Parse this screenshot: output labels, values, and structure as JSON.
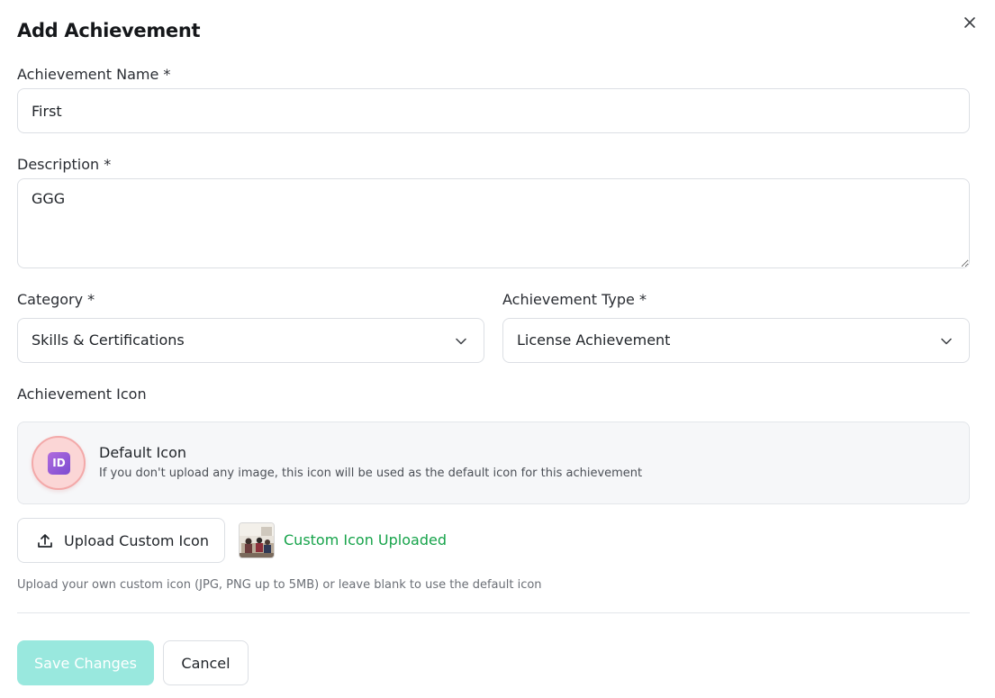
{
  "modal": {
    "title": "Add Achievement",
    "close_icon": "close-icon"
  },
  "form": {
    "name_label": "Achievement Name *",
    "name_value": "First",
    "description_label": "Description *",
    "description_value": "GGG",
    "category_label": "Category *",
    "category_value": "Skills & Certifications",
    "type_label": "Achievement Type *",
    "type_value": "License Achievement",
    "icon_label": "Achievement Icon"
  },
  "default_icon": {
    "badge_text": "ID",
    "title": "Default Icon",
    "description": "If you don't upload any image, this icon will be used as the default icon for this achievement"
  },
  "upload": {
    "button_label": "Upload Custom Icon",
    "status_text": "Custom Icon Uploaded",
    "help_text": "Upload your own custom icon (JPG, PNG up to 5MB) or leave blank to use the default icon"
  },
  "actions": {
    "save_label": "Save Changes",
    "cancel_label": "Cancel"
  },
  "colors": {
    "accent_disabled": "#99e8de",
    "success_text": "#16a34a",
    "default_icon_bg": "#fbd6d6"
  }
}
